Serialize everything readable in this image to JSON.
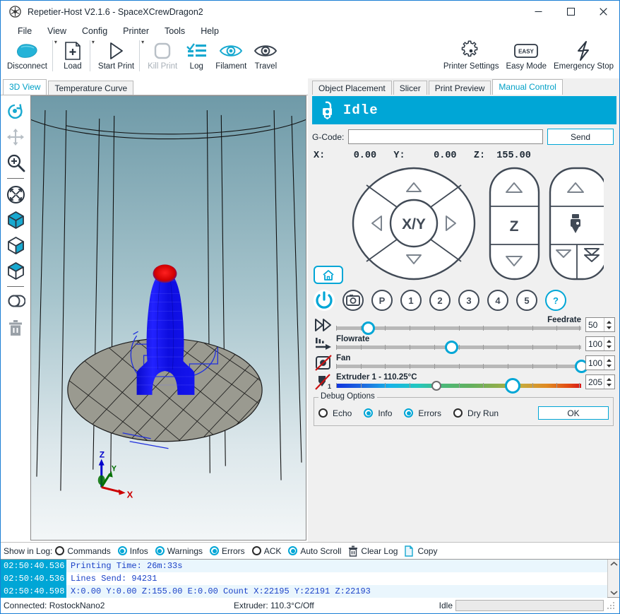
{
  "window": {
    "title": "Repetier-Host V2.1.6 - SpaceXCrewDragon2",
    "app_icon": "repetier-logo-icon",
    "minimize": "—",
    "maximize": "□",
    "close": "✕"
  },
  "menu": {
    "items": [
      {
        "label": "File"
      },
      {
        "label": "View"
      },
      {
        "label": "Config"
      },
      {
        "label": "Printer"
      },
      {
        "label": "Tools"
      },
      {
        "label": "Help"
      }
    ]
  },
  "toolbar": {
    "items": [
      {
        "label": "Disconnect",
        "icon": "plug-icon",
        "disabled": false,
        "dropdown": false
      },
      {
        "label": "Load",
        "icon": "load-file-icon",
        "disabled": false,
        "dropdown": true
      },
      {
        "label": "Start Print",
        "icon": "play-icon",
        "disabled": false,
        "dropdown": true
      },
      {
        "label": "Kill Print",
        "icon": "stop-icon",
        "disabled": true,
        "dropdown": false
      },
      {
        "label": "Log",
        "icon": "log-list-icon",
        "disabled": false,
        "dropdown": false
      },
      {
        "label": "Filament",
        "icon": "eye-icon",
        "disabled": false,
        "dropdown": false
      },
      {
        "label": "Travel",
        "icon": "eye-dark-icon",
        "disabled": false,
        "dropdown": false
      }
    ],
    "right_items": [
      {
        "label": "Printer Settings",
        "icon": "gear-icon"
      },
      {
        "label": "Easy Mode",
        "icon": "easy-badge-icon"
      },
      {
        "label": "Emergency Stop",
        "icon": "lightning-icon"
      }
    ]
  },
  "left_tabs": [
    {
      "label": "3D View",
      "active": true
    },
    {
      "label": "Temperature Curve",
      "active": false
    }
  ],
  "view_tools": [
    {
      "name": "rotate-view-tool",
      "icon": "rotate-icon"
    },
    {
      "name": "move-view-tool",
      "icon": "move-arrows-icon"
    },
    {
      "name": "zoom-view-tool",
      "icon": "magnifier-plus-icon"
    },
    {
      "name": "fit-to-screen-tool",
      "icon": "fit-screen-icon"
    },
    {
      "name": "show-edges-tool",
      "icon": "cube-edges-icon"
    },
    {
      "name": "show-faces-tool",
      "icon": "cube-faces-icon"
    },
    {
      "name": "show-solid-tool",
      "icon": "cube-solid-icon"
    },
    {
      "name": "copy-object-tool",
      "icon": "duplicate-icon"
    },
    {
      "name": "delete-object-tool",
      "icon": "trash-icon"
    }
  ],
  "viewport": {
    "axis_labels": {
      "z": "Z",
      "y": "Y",
      "x": "X"
    },
    "model_color": "#1414ff",
    "model_top_color": "#ee1414",
    "bed_color": "#9a9a90",
    "bg_top": "#6f9aa8",
    "bg_bottom": "#eef2f4"
  },
  "right_tabs": [
    {
      "label": "Object Placement",
      "active": false
    },
    {
      "label": "Slicer",
      "active": false
    },
    {
      "label": "Print Preview",
      "active": false
    },
    {
      "label": "Manual Control",
      "active": true
    }
  ],
  "manual_control": {
    "status_text": "Idle",
    "status_icon": "printer-idle-icon",
    "status_color": "#00a6d6",
    "gcode_label": "G-Code:",
    "gcode_value": "",
    "gcode_placeholder": "",
    "send_label": "Send",
    "coordinates": "X:     0.00   Y:     0.00   Z:  155.00",
    "coord_x": "0.00",
    "coord_y": "0.00",
    "coord_z": "155.00",
    "pads": {
      "xy_label": "X/Y",
      "z_label": "Z",
      "extruder_icon": "extruder-nozzle-icon",
      "home_icon": "home-icon"
    },
    "buttons": [
      {
        "label": "",
        "name": "power-button",
        "icon": "power-icon",
        "accent": true
      },
      {
        "label": "",
        "name": "camera-button",
        "icon": "camera-icon",
        "accent": false
      },
      {
        "label": "P",
        "name": "park-button",
        "accent": false
      },
      {
        "label": "1",
        "name": "macro-1-button",
        "accent": false
      },
      {
        "label": "2",
        "name": "macro-2-button",
        "accent": false
      },
      {
        "label": "3",
        "name": "macro-3-button",
        "accent": false
      },
      {
        "label": "4",
        "name": "macro-4-button",
        "accent": false
      },
      {
        "label": "5",
        "name": "macro-5-button",
        "accent": false
      },
      {
        "label": "?",
        "name": "help-button",
        "accent": true
      }
    ],
    "sliders": [
      {
        "name": "feedrate",
        "label": "Feedrate",
        "value": "50",
        "percent": 13,
        "label_align": "right",
        "icon": "fast-forward-icon",
        "type": "plain"
      },
      {
        "name": "flowrate",
        "label": "Flowrate",
        "value": "100",
        "percent": 47,
        "label_align": "left",
        "icon": "flow-icon",
        "type": "plain"
      },
      {
        "name": "fan",
        "label": "Fan",
        "value": "100",
        "percent": 100,
        "label_align": "left",
        "icon": "fan-off-icon",
        "type": "plain"
      },
      {
        "name": "extruder-1-temp",
        "label": "Extruder 1 - 110.25°C",
        "value": "205",
        "percent": 72,
        "current_percent": 41,
        "label_align": "left",
        "icon": "extruder-off-icon",
        "type": "gradient"
      }
    ],
    "debug": {
      "title": "Debug Options",
      "options": [
        {
          "label": "Echo",
          "checked": false
        },
        {
          "label": "Info",
          "checked": true
        },
        {
          "label": "Errors",
          "checked": true
        },
        {
          "label": "Dry Run",
          "checked": false
        }
      ],
      "ok_label": "OK"
    }
  },
  "log_panel": {
    "show_label": "Show in Log:",
    "filters": [
      {
        "label": "Commands",
        "checked": false
      },
      {
        "label": "Infos",
        "checked": true
      },
      {
        "label": "Warnings",
        "checked": true
      },
      {
        "label": "Errors",
        "checked": true
      },
      {
        "label": "ACK",
        "checked": false
      },
      {
        "label": "Auto Scroll",
        "checked": true
      }
    ],
    "clear_label": "Clear Log",
    "clear_icon": "trash-icon",
    "copy_label": "Copy",
    "copy_icon": "copy-icon",
    "entries": [
      {
        "time": "02:50:40.536",
        "text": "Printing Time: 26m:33s"
      },
      {
        "time": "02:50:40.536",
        "text": "Lines Send: 94231"
      },
      {
        "time": "02:50:40.598",
        "text": "X:0.00 Y:0.00 Z:155.00 E:0.00 Count X:22195 Y:22191 Z:22193"
      }
    ],
    "scroll_up_icon": "chevron-up-icon",
    "scroll_down_icon": "chevron-down-icon"
  },
  "status_bar": {
    "connection": "Connected: RostockNano2",
    "extruder": "Extruder: 110.3°C/Off",
    "state": "Idle",
    "progress_percent": 0
  }
}
